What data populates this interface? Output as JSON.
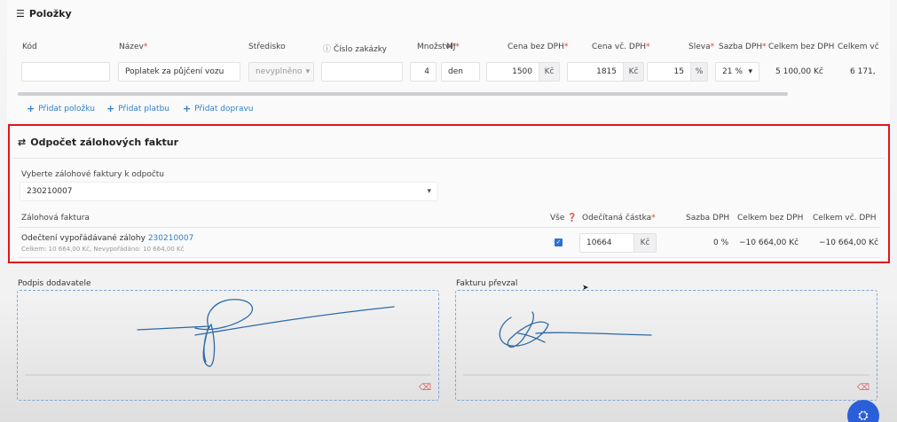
{
  "items_section": {
    "title": "Položky",
    "headers": {
      "kod": "Kód",
      "nazev": "Název",
      "stredisko": "Středisko",
      "cislo_zakazky": "Číslo zakázky",
      "mnozstvi": "Množství",
      "mj": "MJ",
      "cena_bez": "Cena bez DPH",
      "cena_vc": "Cena vč. DPH",
      "sleva": "Sleva",
      "sazba": "Sazba DPH",
      "celkem_bez": "Celkem bez DPH",
      "celkem_vc": "Celkem vč"
    },
    "row": {
      "kod": "",
      "nazev": "Poplatek za půjčení vozu",
      "stredisko": "nevyplněno",
      "cislo_zakazky": "",
      "mnozstvi": "4",
      "mj": "den",
      "cena_bez": "1500",
      "cena_bez_unit": "Kč",
      "cena_vc": "1815",
      "cena_vc_unit": "Kč",
      "sleva": "15",
      "sleva_unit": "%",
      "sazba": "21 %",
      "celkem_bez": "5 100,00 Kč",
      "celkem_vc": "6 171,"
    },
    "links": {
      "add_item": "Přidat položku",
      "add_payment": "Přidat platbu",
      "add_shipping": "Přidat dopravu"
    }
  },
  "deposit_section": {
    "title": "Odpočet zálohových faktur",
    "select_label": "Vyberte zálohové faktury k odpočtu",
    "select_value": "230210007",
    "headers": {
      "faktura": "Zálohová faktura",
      "vse": "Vše",
      "odecitana": "Odečítaná částka",
      "sazba": "Sazba DPH",
      "celkem_bez": "Celkem bez DPH",
      "celkem_vc": "Celkem vč. DPH"
    },
    "row": {
      "desc_prefix": "Odečtení vypořádávané zálohy",
      "desc_link": "230210007",
      "sub": "Celkem: 10 664,00 Kč, Nevypořádáno: 10 664,00 Kč",
      "checked": "✓",
      "amount": "10664",
      "amount_unit": "Kč",
      "sazba": "0 %",
      "celkem_bez": "−10 664,00 Kč",
      "celkem_vc": "−10 664,00 Kč"
    }
  },
  "signatures": {
    "supplier_label": "Podpis dodavatele",
    "receiver_label": "Fakturu převzal"
  },
  "colors": {
    "accent": "#2f80c9",
    "highlight": "#e3151a",
    "signature_ink": "#2e6aa6"
  }
}
